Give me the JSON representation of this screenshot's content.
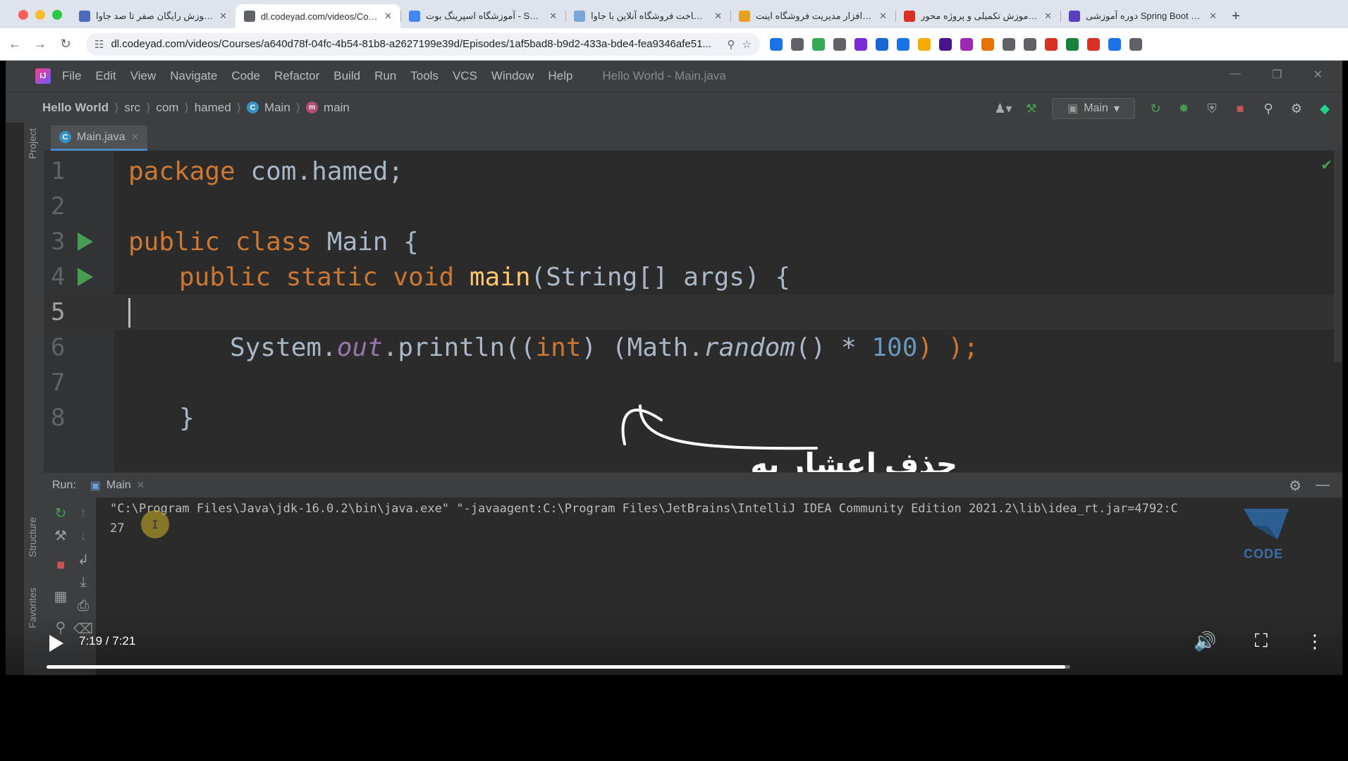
{
  "browser": {
    "tabs": [
      {
        "title": "آموزش رایگان صفر تا صد جاوا (Java)",
        "fav_color": "#4b6ab8",
        "active": false
      },
      {
        "title": "dl.codeyad.com/videos/Courses",
        "fav_color": "#5f6368",
        "active": true
      },
      {
        "title": "آموزشگاه اسپرینگ بوت - Search",
        "fav_color": "#4285f4",
        "active": false
      },
      {
        "title": "نحوه ساخت فروشگاه آنلاین با جاوا",
        "fav_color": "#7aa6d8",
        "active": false
      },
      {
        "title": "پروژه نرم افزار مدیریت فروشگاه اینت...",
        "fav_color": "#e6a21f",
        "active": false
      },
      {
        "title": "آموزش تکمیلی و پروژه محور Boot",
        "fav_color": "#d93025",
        "active": false
      },
      {
        "title": "دوره آموزشی Spring Boot & Framework",
        "fav_color": "#5a3fc0",
        "active": false
      }
    ],
    "url": "dl.codeyad.com/videos/Courses/a640d78f-04fc-4b54-81b8-a2627199e39d/Episodes/1af5bad8-b9d2-433a-bde4-fea9346afe51...",
    "ext_colors": [
      "#1a73e8",
      "#5f6368",
      "#34a853",
      "#5f6368",
      "#7b2bd6",
      "#1967d2",
      "#1a73e8",
      "#f9ab00",
      "#4a148c",
      "#9c27b0",
      "#e37400",
      "#5f6368",
      "#5f6368",
      "#d93025",
      "#188038",
      "#d93025",
      "#1a73e8",
      "#5f6368"
    ]
  },
  "ide": {
    "menu": [
      "File",
      "Edit",
      "View",
      "Navigate",
      "Code",
      "Refactor",
      "Build",
      "Run",
      "Tools",
      "VCS",
      "Window",
      "Help"
    ],
    "window_title": "Hello World - Main.java",
    "breadcrumbs": {
      "project": "Hello World",
      "src": "src",
      "pkg1": "com",
      "pkg2": "hamed",
      "cls": "Main",
      "method": "main"
    },
    "run_config": "Main",
    "editor_tab": "Main.java",
    "project_label": "Project",
    "structure_label": "Structure",
    "favorites_label": "Favorites",
    "lines": [
      {
        "n": "1"
      },
      {
        "n": "2"
      },
      {
        "n": "3"
      },
      {
        "n": "4"
      },
      {
        "n": "5"
      },
      {
        "n": "6"
      },
      {
        "n": "7"
      },
      {
        "n": "8"
      }
    ],
    "code": {
      "l1_kw": "package",
      "l1_rest": " com.hamed;",
      "l3_kw": "public class",
      "l3_rest": " Main {",
      "l4_kw": "public static void",
      "l4_fn": "main",
      "l4_rest": "(String[] args) {",
      "l6_a": "System.",
      "l6_out": "out",
      "l6_b": ".println((",
      "l6_int": "int",
      "l6_c": ") (Math.",
      "l6_rand": "random",
      "l6_d": "() * ",
      "l6_num": "100",
      "l6_e": ") );",
      "l8": "}"
    },
    "annotation": "حذف اعشار به روش دیگر",
    "run": {
      "label": "Run:",
      "tab": "Main",
      "cmd": "\"C:\\Program Files\\Java\\jdk-16.0.2\\bin\\java.exe\" \"-javaagent:C:\\Program Files\\JetBrains\\IntelliJ IDEA Community Edition 2021.2\\lib\\idea_rt.jar=4792:C",
      "output": "27"
    },
    "watermark": "CODE"
  },
  "video": {
    "time": "7:19 / 7:21",
    "progress": 0.995
  }
}
